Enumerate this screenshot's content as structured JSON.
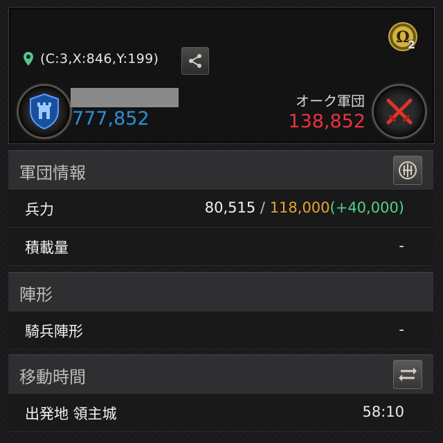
{
  "top": {
    "coord_text": "(C:3,X:846,Y:199)",
    "omega_badge": "2",
    "player_power": "777,852",
    "enemy_name": "オーク軍団",
    "enemy_power": "138,852"
  },
  "sections": {
    "army": {
      "title": "軍団情報",
      "rows": [
        {
          "label": "兵力",
          "current": "80,515",
          "separator": "/",
          "max": "118,000",
          "bonus": "(+40,000)"
        },
        {
          "label": "積載量",
          "value": "-"
        }
      ]
    },
    "formation": {
      "title": "陣形",
      "row": {
        "label": "騎兵陣形",
        "value": "-"
      }
    },
    "move": {
      "title": "移動時間",
      "row": {
        "label": "出発地 領主城",
        "value": "58:10"
      }
    }
  },
  "colors": {
    "player_power": "#2d8fd5",
    "enemy_power": "#e8343a",
    "max_troops": "#e6a52e",
    "bonus_troops": "#52d38a"
  },
  "icons": [
    "location-pin-icon",
    "share-icon",
    "omega-icon",
    "shield-castle-icon",
    "crossed-swords-icon",
    "info-sword-icon",
    "swap-arrows-icon"
  ]
}
